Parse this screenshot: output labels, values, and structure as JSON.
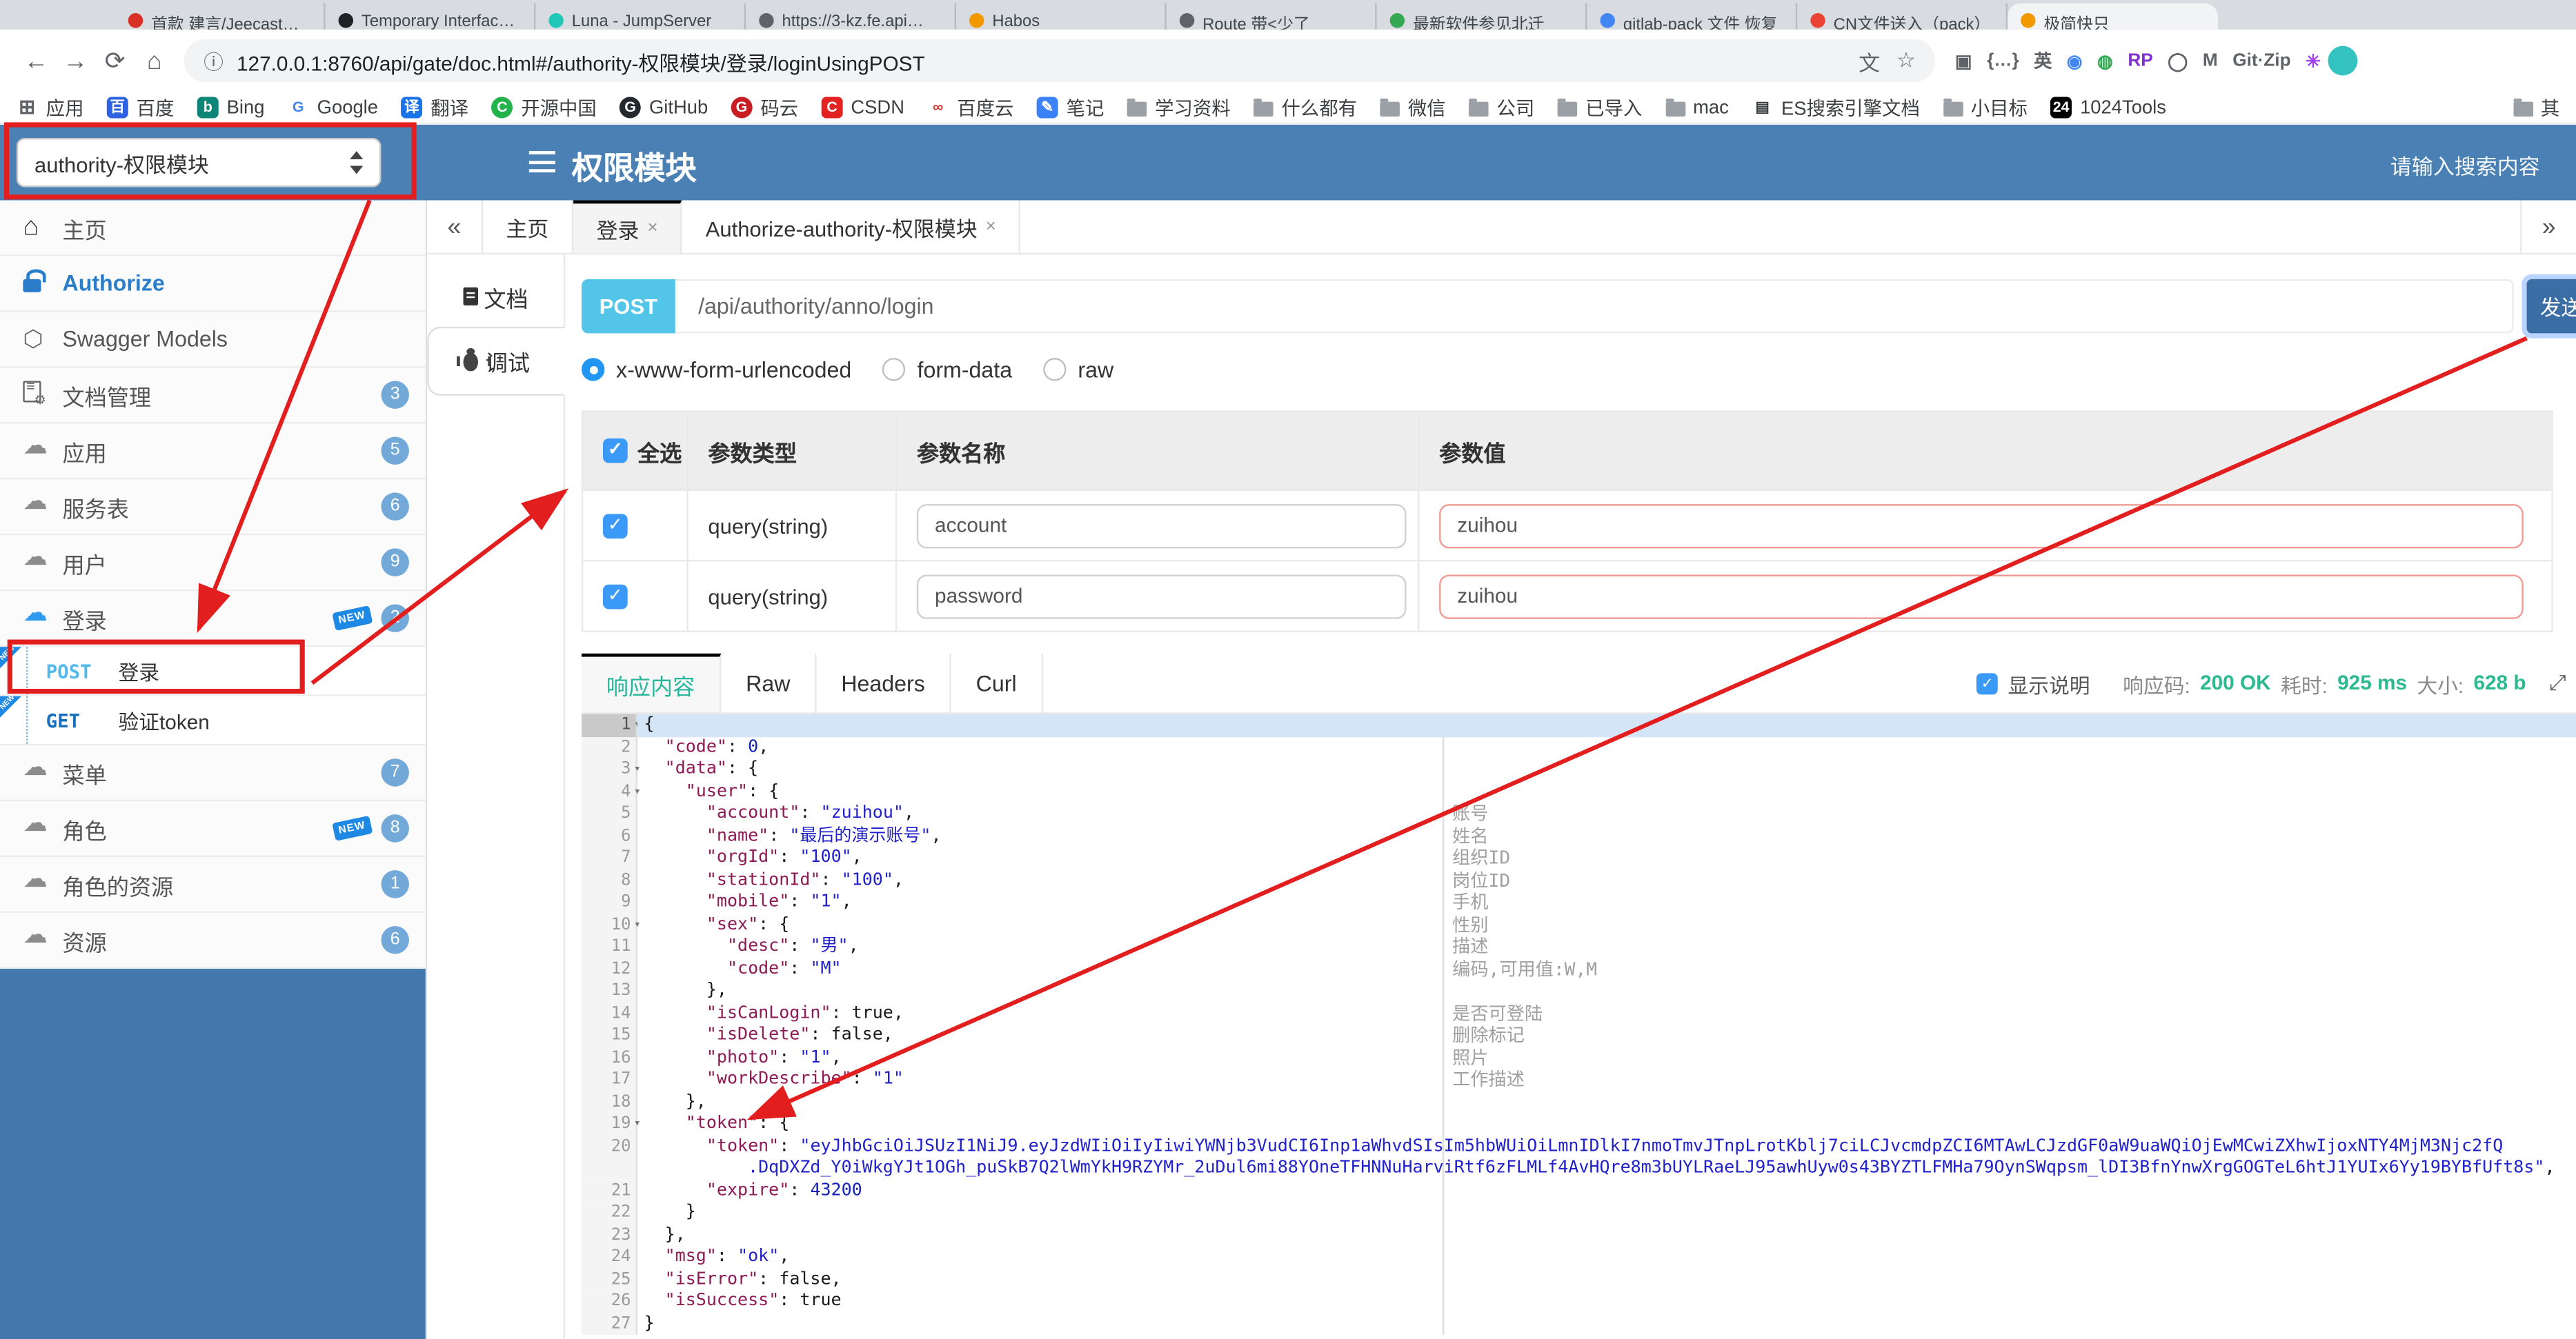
{
  "browser": {
    "tabs": [
      {
        "label": "首款 建言/Jeecast…",
        "color": "#d93025"
      },
      {
        "label": "Temporary Interfac…",
        "color": "#202124"
      },
      {
        "label": "Luna - JumpServer",
        "color": "#21c7b6"
      },
      {
        "label": "https://3-kz.fe.api…",
        "color": "#5f6368"
      },
      {
        "label": "Habos",
        "color": "#f29900"
      },
      {
        "label": "Route 带<少了",
        "color": "#5f6368"
      },
      {
        "label": "最新软件参见北迁",
        "color": "#34a853"
      },
      {
        "label": "gitlab-pack 文件 恢复",
        "color": "#4285f4"
      },
      {
        "label": "CN文件送入（pack）",
        "color": "#ea4335"
      },
      {
        "label": "极简快只",
        "color": "#f29900",
        "active": true
      }
    ],
    "url": "127.0.0.1:8760/api/gate/doc.html#/authority-权限模块/登录/loginUsingPOST",
    "info_icon": "ⓘ",
    "translate_icon": "文",
    "star_icon": "☆",
    "back_icon": "←",
    "forward_icon": "→",
    "reload_icon": "⟳",
    "home_icon": "⌂",
    "extensions": [
      {
        "name": "scan-icon",
        "glyph": "▣"
      },
      {
        "name": "braces-icon",
        "glyph": "{…}"
      },
      {
        "name": "en-translate-icon",
        "glyph": "英"
      },
      {
        "name": "colorful-ball-icon",
        "glyph": "◉",
        "color": "#4285f4"
      },
      {
        "name": "globe-icon",
        "glyph": "◍",
        "color": "#34a853"
      },
      {
        "name": "rp-icon",
        "glyph": "RP",
        "color": "#8430ce"
      },
      {
        "name": "ring-icon",
        "glyph": "◯"
      },
      {
        "name": "m-chevron-icon",
        "glyph": "M"
      },
      {
        "name": "gitzip-icon",
        "glyph": "Git·Zip"
      },
      {
        "name": "asterisk-icon",
        "glyph": "✳",
        "color": "#a142f4"
      }
    ],
    "bookmarks": [
      {
        "label": "应用",
        "icon": "apps",
        "text": "⊞",
        "fg": "#5f6368"
      },
      {
        "label": "百度",
        "icon": "letter",
        "text": "百",
        "bg": "#2d63e0"
      },
      {
        "label": "Bing",
        "icon": "letter",
        "text": "b",
        "bg": "#0d8577"
      },
      {
        "label": "Google",
        "icon": "letter",
        "text": "G",
        "bg": "#fff",
        "fg": "#4285f4"
      },
      {
        "label": "翻译",
        "icon": "letter",
        "text": "译",
        "bg": "#1a73e8"
      },
      {
        "label": "开源中国",
        "icon": "letter",
        "text": "C",
        "bg": "#24b34b",
        "round": true
      },
      {
        "label": "GitHub",
        "icon": "letter",
        "text": "G",
        "bg": "#24292e",
        "round": true
      },
      {
        "label": "码云",
        "icon": "letter",
        "text": "G",
        "bg": "#c71d23",
        "round": true
      },
      {
        "label": "CSDN",
        "icon": "letter",
        "text": "C",
        "bg": "#e32222"
      },
      {
        "label": "百度云",
        "icon": "letter",
        "text": "∞",
        "bg": "#fff",
        "fg": "#d93b30"
      },
      {
        "label": "笔记",
        "icon": "letter",
        "text": "✎",
        "bg": "#3b82f6"
      },
      {
        "label": "学习资料",
        "icon": "folder"
      },
      {
        "label": "什么都有",
        "icon": "folder"
      },
      {
        "label": "微信",
        "icon": "folder"
      },
      {
        "label": "公司",
        "icon": "folder"
      },
      {
        "label": "已导入",
        "icon": "folder"
      },
      {
        "label": "mac",
        "icon": "folder"
      },
      {
        "label": "ES搜索引擎文档",
        "icon": "letter",
        "text": "▤",
        "bg": "#fff",
        "fg": "#3c4043"
      },
      {
        "label": "小目标",
        "icon": "folder"
      },
      {
        "label": "1024Tools",
        "icon": "letter",
        "text": "24",
        "bg": "#000"
      }
    ],
    "bookmarks_overflow": {
      "label": "其",
      "icon": "folder"
    }
  },
  "header": {
    "module_select": "authority-权限模块",
    "title": "权限模块",
    "search_placeholder": "请输入搜索内容"
  },
  "sidebar": {
    "new_badge_label": "NEW",
    "items": [
      {
        "type": "item",
        "icon": "home-icon",
        "label": "主页"
      },
      {
        "type": "item",
        "icon": "lock-icon",
        "label": "Authorize",
        "style": "auth"
      },
      {
        "type": "item",
        "icon": "hexagon-icon",
        "label": "Swagger Models"
      },
      {
        "type": "item",
        "icon": "doc-gear-icon",
        "label": "文档管理",
        "badge": "3"
      },
      {
        "type": "item",
        "icon": "cloud-api-icon",
        "label": "应用",
        "badge": "5"
      },
      {
        "type": "item",
        "icon": "cloud-api-icon",
        "label": "服务表",
        "badge": "6"
      },
      {
        "type": "item",
        "icon": "cloud-api-icon",
        "label": "用户",
        "badge": "9"
      },
      {
        "type": "item",
        "icon": "cloud-api-icon",
        "label": "登录",
        "badge": "2",
        "new": true,
        "open": true
      },
      {
        "type": "op",
        "method": "POST",
        "label": "登录",
        "new": true
      },
      {
        "type": "op",
        "method": "GET",
        "label": "验证token",
        "new": true
      },
      {
        "type": "item",
        "icon": "cloud-api-icon",
        "label": "菜单",
        "badge": "7"
      },
      {
        "type": "item",
        "icon": "cloud-api-icon",
        "label": "角色",
        "badge": "8",
        "new": true
      },
      {
        "type": "item",
        "icon": "cloud-api-icon",
        "label": "角色的资源",
        "badge": "1"
      },
      {
        "type": "item",
        "icon": "cloud-api-icon",
        "label": "资源",
        "badge": "6"
      }
    ]
  },
  "content": {
    "tabbar": {
      "collapse_icon": "«",
      "expand_icon": "»",
      "close_icon": "×",
      "tabs": [
        {
          "label": "主页"
        },
        {
          "label": "登录",
          "closable": true,
          "active": true
        },
        {
          "label": "Authorize-authority-权限模块",
          "closable": true
        }
      ]
    },
    "doc_tabs": [
      {
        "label": "文档",
        "icon": "doc-icon"
      },
      {
        "label": "调试",
        "icon": "bug-icon",
        "active": true
      }
    ],
    "endpoint": {
      "method": "POST",
      "path": "/api/authority/anno/login",
      "send_label": "发送"
    },
    "body_types": [
      {
        "label": "x-www-form-urlencoded",
        "checked": true
      },
      {
        "label": "form-data",
        "checked": false
      },
      {
        "label": "raw",
        "checked": false
      }
    ],
    "params": {
      "headers": [
        "全选",
        "参数类型",
        "参数名称",
        "参数值"
      ],
      "check_glyph": "✓",
      "rows": [
        {
          "checked": true,
          "type": "query(string)",
          "name": "account",
          "value": "zuihou"
        },
        {
          "checked": true,
          "type": "query(string)",
          "name": "password",
          "value": "zuihou"
        }
      ]
    },
    "response": {
      "tabs": [
        {
          "label": "响应内容",
          "active": true
        },
        {
          "label": "Raw"
        },
        {
          "label": "Headers"
        },
        {
          "label": "Curl"
        }
      ],
      "show_desc_label": "显示说明",
      "code_label": "响应码:",
      "code_value": "200 OK",
      "time_label": "耗时:",
      "time_value": "925 ms",
      "size_label": "大小:",
      "size_value": "628 b",
      "expand_icon": "⤢"
    },
    "editor": {
      "fold_glyph": "▾",
      "lines": [
        {
          "n": 1,
          "fold": true,
          "hl": true,
          "seg": [
            [
              "p",
              "{"
            ]
          ]
        },
        {
          "n": 2,
          "seg": [
            [
              "p",
              "  "
            ],
            [
              "k",
              "\"code\""
            ],
            [
              "p",
              ": "
            ],
            [
              "n",
              "0"
            ],
            [
              "p",
              ","
            ]
          ]
        },
        {
          "n": 3,
          "fold": true,
          "seg": [
            [
              "p",
              "  "
            ],
            [
              "k",
              "\"data\""
            ],
            [
              "p",
              ": {"
            ]
          ]
        },
        {
          "n": 4,
          "fold": true,
          "seg": [
            [
              "p",
              "    "
            ],
            [
              "k",
              "\"user\""
            ],
            [
              "p",
              ": {"
            ]
          ]
        },
        {
          "n": 5,
          "seg": [
            [
              "p",
              "      "
            ],
            [
              "k",
              "\"account\""
            ],
            [
              "p",
              ": "
            ],
            [
              "s",
              "\"zuihou\""
            ],
            [
              "p",
              ","
            ]
          ]
        },
        {
          "n": 6,
          "seg": [
            [
              "p",
              "      "
            ],
            [
              "k",
              "\"name\""
            ],
            [
              "p",
              ": "
            ],
            [
              "s",
              "\"最后的演示账号\""
            ],
            [
              "p",
              ","
            ]
          ]
        },
        {
          "n": 7,
          "seg": [
            [
              "p",
              "      "
            ],
            [
              "k",
              "\"orgId\""
            ],
            [
              "p",
              ": "
            ],
            [
              "s",
              "\"100\""
            ],
            [
              "p",
              ","
            ]
          ]
        },
        {
          "n": 8,
          "seg": [
            [
              "p",
              "      "
            ],
            [
              "k",
              "\"stationId\""
            ],
            [
              "p",
              ": "
            ],
            [
              "s",
              "\"100\""
            ],
            [
              "p",
              ","
            ]
          ]
        },
        {
          "n": 9,
          "seg": [
            [
              "p",
              "      "
            ],
            [
              "k",
              "\"mobile\""
            ],
            [
              "p",
              ": "
            ],
            [
              "s",
              "\"1\""
            ],
            [
              "p",
              ","
            ]
          ]
        },
        {
          "n": 10,
          "fold": true,
          "seg": [
            [
              "p",
              "      "
            ],
            [
              "k",
              "\"sex\""
            ],
            [
              "p",
              ": {"
            ]
          ]
        },
        {
          "n": 11,
          "seg": [
            [
              "p",
              "        "
            ],
            [
              "k",
              "\"desc\""
            ],
            [
              "p",
              ": "
            ],
            [
              "s",
              "\"男\""
            ],
            [
              "p",
              ","
            ]
          ]
        },
        {
          "n": 12,
          "seg": [
            [
              "p",
              "        "
            ],
            [
              "k",
              "\"code\""
            ],
            [
              "p",
              ": "
            ],
            [
              "s",
              "\"M\""
            ]
          ]
        },
        {
          "n": 13,
          "seg": [
            [
              "p",
              "      },"
            ]
          ]
        },
        {
          "n": 14,
          "seg": [
            [
              "p",
              "      "
            ],
            [
              "k",
              "\"isCanLogin\""
            ],
            [
              "p",
              ": true,"
            ]
          ]
        },
        {
          "n": 15,
          "seg": [
            [
              "p",
              "      "
            ],
            [
              "k",
              "\"isDelete\""
            ],
            [
              "p",
              ": false,"
            ]
          ]
        },
        {
          "n": 16,
          "seg": [
            [
              "p",
              "      "
            ],
            [
              "k",
              "\"photo\""
            ],
            [
              "p",
              ": "
            ],
            [
              "s",
              "\"1\""
            ],
            [
              "p",
              ","
            ]
          ]
        },
        {
          "n": 17,
          "seg": [
            [
              "p",
              "      "
            ],
            [
              "k",
              "\"workDescribe\""
            ],
            [
              "p",
              ": "
            ],
            [
              "s",
              "\"1\""
            ]
          ]
        },
        {
          "n": 18,
          "seg": [
            [
              "p",
              "    },"
            ]
          ]
        },
        {
          "n": 19,
          "fold": true,
          "seg": [
            [
              "p",
              "    "
            ],
            [
              "k",
              "\"token\""
            ],
            [
              "p",
              ": {"
            ]
          ]
        },
        {
          "n": 20,
          "seg": [
            [
              "p",
              "      "
            ],
            [
              "k",
              "\"token\""
            ],
            [
              "p",
              ": "
            ],
            [
              "s",
              "\"eyJhbGciOiJSUzI1NiJ9.eyJzdWIiOiIyIiwiYWNjb3VudCI6Inp1aWhvdSIsIm5hbWUiOiLmnIDlkI7nmoTmvJTnpLrotKblj7ciLCJvcmdpZCI6MTAwLCJzdGF0aW9uaWQiOjEwMCwiZXhwIjoxNTY4MjM3Njc2fQ"
            ]
          ],
          "wrap": [
            [
              "p",
              "          "
            ],
            [
              "s",
              ".DqDXZd_Y0iWkgYJt1OGh_puSkB7Q2lWmYkH9RZYMr_2uDul6mi88YOneTFHNNuHarviRtf6zFLMLf4AvHQre8m3bUYLRaeLJ95awhUyw0s43BYZTLFMHa79OynSWqpsm_lDI3BfnYnwXrgGOGTeL6htJ1YUIx6Yy19BYBfUft8s\""
            ],
            [
              "p",
              ","
            ]
          ]
        },
        {
          "n": 21,
          "seg": [
            [
              "p",
              "      "
            ],
            [
              "k",
              "\"expire\""
            ],
            [
              "p",
              ": "
            ],
            [
              "n",
              "43200"
            ]
          ]
        },
        {
          "n": 22,
          "seg": [
            [
              "p",
              "    }"
            ]
          ]
        },
        {
          "n": 23,
          "seg": [
            [
              "p",
              "  },"
            ]
          ]
        },
        {
          "n": 24,
          "seg": [
            [
              "p",
              "  "
            ],
            [
              "k",
              "\"msg\""
            ],
            [
              "p",
              ": "
            ],
            [
              "s",
              "\"ok\""
            ],
            [
              "p",
              ","
            ]
          ]
        },
        {
          "n": 25,
          "seg": [
            [
              "p",
              "  "
            ],
            [
              "k",
              "\"isError\""
            ],
            [
              "p",
              ": false,"
            ]
          ]
        },
        {
          "n": 26,
          "seg": [
            [
              "p",
              "  "
            ],
            [
              "k",
              "\"isSuccess\""
            ],
            [
              "p",
              ": true"
            ]
          ]
        },
        {
          "n": 27,
          "seg": [
            [
              "p",
              "}"
            ]
          ]
        }
      ],
      "descriptions": [
        {
          "line": 5,
          "text": "账号"
        },
        {
          "line": 6,
          "text": "姓名"
        },
        {
          "line": 7,
          "text": "组织ID"
        },
        {
          "line": 8,
          "text": "岗位ID"
        },
        {
          "line": 9,
          "text": "手机"
        },
        {
          "line": 10,
          "text": "性别"
        },
        {
          "line": 11,
          "text": "描述"
        },
        {
          "line": 12,
          "text": "编码,可用值:W,M"
        },
        {
          "line": 14,
          "text": "是否可登陆"
        },
        {
          "line": 15,
          "text": "删除标记"
        },
        {
          "line": 16,
          "text": "照片"
        },
        {
          "line": 17,
          "text": "工作描述"
        }
      ]
    }
  },
  "annotation_color": "#e31e1e"
}
